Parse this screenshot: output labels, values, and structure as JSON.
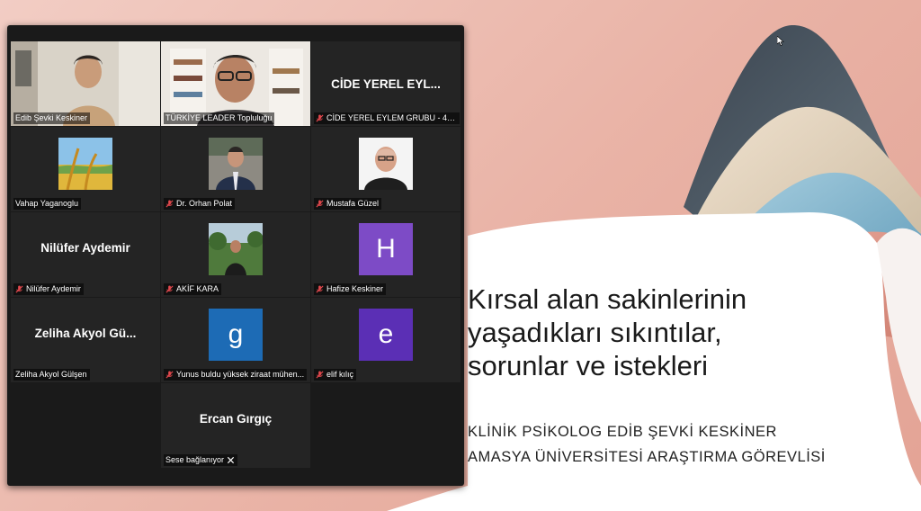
{
  "slide": {
    "title": "Kırsal alan sakinlerinin\nyaşadıkları sıkıntılar,\nsorunlar ve istekleri",
    "subtitle_line1": "KLİNİK PSİKOLOG EDİB ŞEVKİ KESKİNER",
    "subtitle_line2": "AMASYA ÜNİVERSİTESİ ARAŞTIRMA GÖREVLİSİ"
  },
  "colors": {
    "active_speaker_border": "#c6e25a",
    "muted_icon": "#e2484d",
    "avatar_blue": "#1d6bb5",
    "avatar_purple": "#5b2fb5",
    "avatar_violet": "#7d4bc6"
  },
  "participants": [
    {
      "name": "Edib Şevki Keskiner",
      "muted": false,
      "type": "video"
    },
    {
      "name": "TÜRKİYE LEADER Topluluğu",
      "muted": false,
      "type": "video",
      "active": true
    },
    {
      "name": "CİDE YEREL EYLEM GRUBU - 4 KA...",
      "display": "CİDE YEREL EYL...",
      "muted": true,
      "type": "name"
    },
    {
      "name": "Vahap Yaganoglu",
      "muted": false,
      "type": "photo",
      "icon": "wheat-field-photo"
    },
    {
      "name": "Dr. Orhan Polat",
      "muted": true,
      "type": "photo",
      "icon": "man-in-suit-photo"
    },
    {
      "name": "Mustafa Güzel",
      "muted": true,
      "type": "photo",
      "icon": "bald-man-photo"
    },
    {
      "name": "Nilüfer Aydemir",
      "display": "Nilüfer Aydemir",
      "muted": true,
      "type": "name"
    },
    {
      "name": "AKİF KARA",
      "muted": true,
      "type": "photo",
      "icon": "man-outdoors-photo"
    },
    {
      "name": "Hafize Keskiner",
      "muted": true,
      "type": "letter",
      "letter": "H"
    },
    {
      "name": "Zeliha Akyol Gülşen",
      "display": "Zeliha Akyol Gü...",
      "muted": false,
      "type": "name"
    },
    {
      "name": "Yunus buldu yüksek ziraat mühen...",
      "muted": true,
      "type": "letter",
      "letter": "g"
    },
    {
      "name": "elif kılıç",
      "muted": true,
      "type": "letter",
      "letter": "e"
    },
    {
      "name": "Sese bağlanıyor",
      "display": "Ercan Gırgıç",
      "muted": false,
      "type": "connecting"
    }
  ]
}
